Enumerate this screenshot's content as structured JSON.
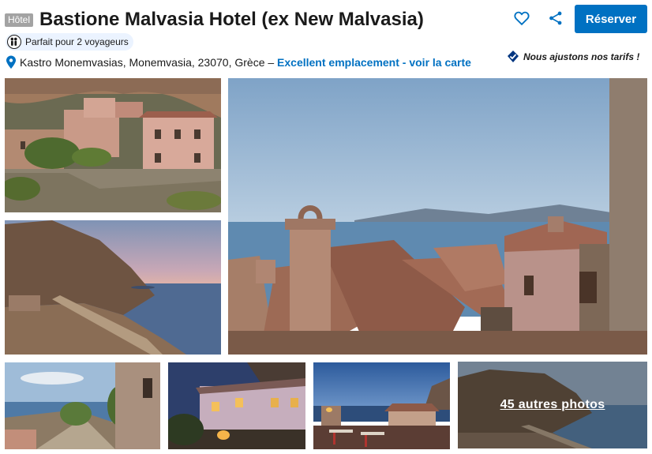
{
  "header": {
    "type_badge": "Hôtel",
    "title": "Bastione Malvasia Hotel (ex New Malvasia)",
    "reserve_label": "Réserver",
    "travelers_label": "Parfait pour 2 voyageurs",
    "address": "Kastro Monemvasias, Monemvasia, 23070, Grèce –",
    "location_link": "Excellent emplacement - voir la carte",
    "price_match": "Nous ajustons nos tarifs !"
  },
  "icons": {
    "favorite": "heart-icon",
    "share": "share-icon",
    "pin": "map-pin-icon",
    "travelers": "two-people-icon",
    "price_match": "shield-check-icon"
  },
  "gallery": {
    "photos": [
      {
        "id": "photo-1",
        "scene": "pink stone hotel on cliff"
      },
      {
        "id": "photo-2",
        "scene": "cliff and sea at dusk"
      },
      {
        "id": "photo-3",
        "scene": "chimney and tile roofs over sea"
      },
      {
        "id": "photo-4",
        "scene": "stone alley with sea"
      },
      {
        "id": "photo-5",
        "scene": "hotel facade at night"
      },
      {
        "id": "photo-6",
        "scene": "terrace at dusk"
      }
    ],
    "more_label": "45 autres photos"
  },
  "colors": {
    "accent": "#0071c2",
    "badge": "#a3a3a3",
    "travel_bg": "#ebf3ff"
  }
}
